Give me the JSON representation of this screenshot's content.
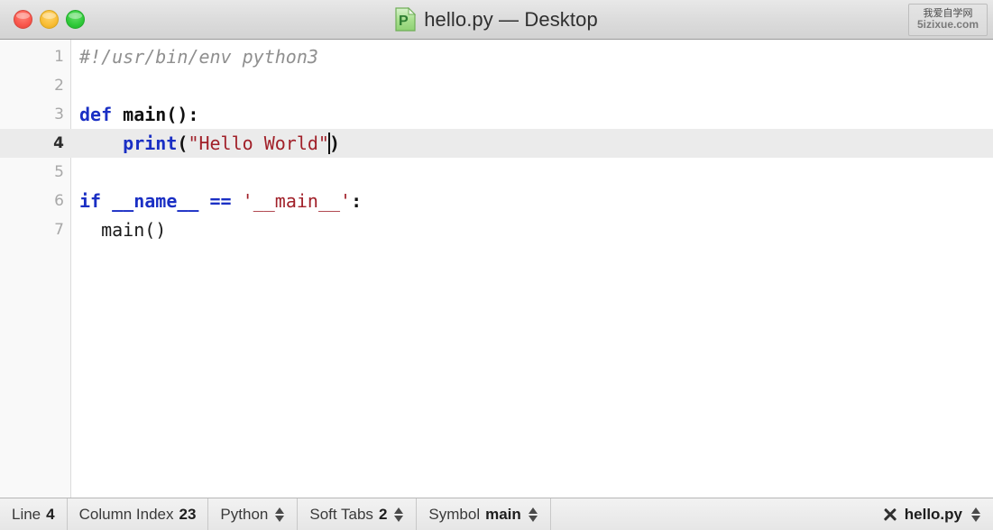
{
  "window": {
    "title": "hello.py — Desktop",
    "doc_icon": "python-document-icon",
    "traffic_lights": [
      {
        "name": "close-button",
        "color": "#f9564c"
      },
      {
        "name": "minimize-button",
        "color": "#f9bd35"
      },
      {
        "name": "maximize-button",
        "color": "#2ec938"
      }
    ]
  },
  "watermark": {
    "line1": "我爱自学网",
    "line2": "5izixue.com"
  },
  "editor": {
    "language": "Python",
    "active_line": 4,
    "lines": [
      {
        "number": "1",
        "active": false,
        "tokens": [
          {
            "text": "#!/usr/bin/env python3",
            "type": "comment"
          }
        ]
      },
      {
        "number": "2",
        "active": false,
        "tokens": []
      },
      {
        "number": "3",
        "active": false,
        "tokens": [
          {
            "text": "def",
            "type": "kw"
          },
          {
            "text": " ",
            "type": "plain"
          },
          {
            "text": "main",
            "type": "name"
          },
          {
            "text": "():",
            "type": "punct"
          }
        ]
      },
      {
        "number": "4",
        "active": true,
        "tokens": [
          {
            "text": "    ",
            "type": "plain"
          },
          {
            "text": "print",
            "type": "fn"
          },
          {
            "text": "(",
            "type": "punct"
          },
          {
            "text": "\"Hello World\"",
            "type": "str"
          },
          {
            "text": "",
            "type": "caret"
          },
          {
            "text": ")",
            "type": "punct"
          }
        ]
      },
      {
        "number": "5",
        "active": false,
        "tokens": []
      },
      {
        "number": "6",
        "active": false,
        "tokens": [
          {
            "text": "if",
            "type": "kw"
          },
          {
            "text": " ",
            "type": "plain"
          },
          {
            "text": "__name__",
            "type": "kw"
          },
          {
            "text": " ",
            "type": "plain"
          },
          {
            "text": "==",
            "type": "kw"
          },
          {
            "text": " ",
            "type": "plain"
          },
          {
            "text": "'__main__'",
            "type": "str"
          },
          {
            "text": ":",
            "type": "punct"
          }
        ]
      },
      {
        "number": "7",
        "active": false,
        "tokens": [
          {
            "text": "  main()",
            "type": "plain"
          }
        ]
      }
    ]
  },
  "statusbar": {
    "items": [
      {
        "name": "line-indicator",
        "label": "Line",
        "value": "4",
        "stepper": false
      },
      {
        "name": "column-index-indicator",
        "label": "Column Index",
        "value": "23",
        "stepper": false
      },
      {
        "name": "language-selector",
        "label": "Python",
        "value": "",
        "stepper": true
      },
      {
        "name": "soft-tabs-selector",
        "label": "Soft Tabs",
        "value": "2",
        "stepper": true
      },
      {
        "name": "symbol-selector",
        "label": "Symbol",
        "value": "main",
        "stepper": true
      }
    ],
    "file": {
      "name": "hello.py",
      "close_icon": "close-icon",
      "stepper": true
    }
  }
}
